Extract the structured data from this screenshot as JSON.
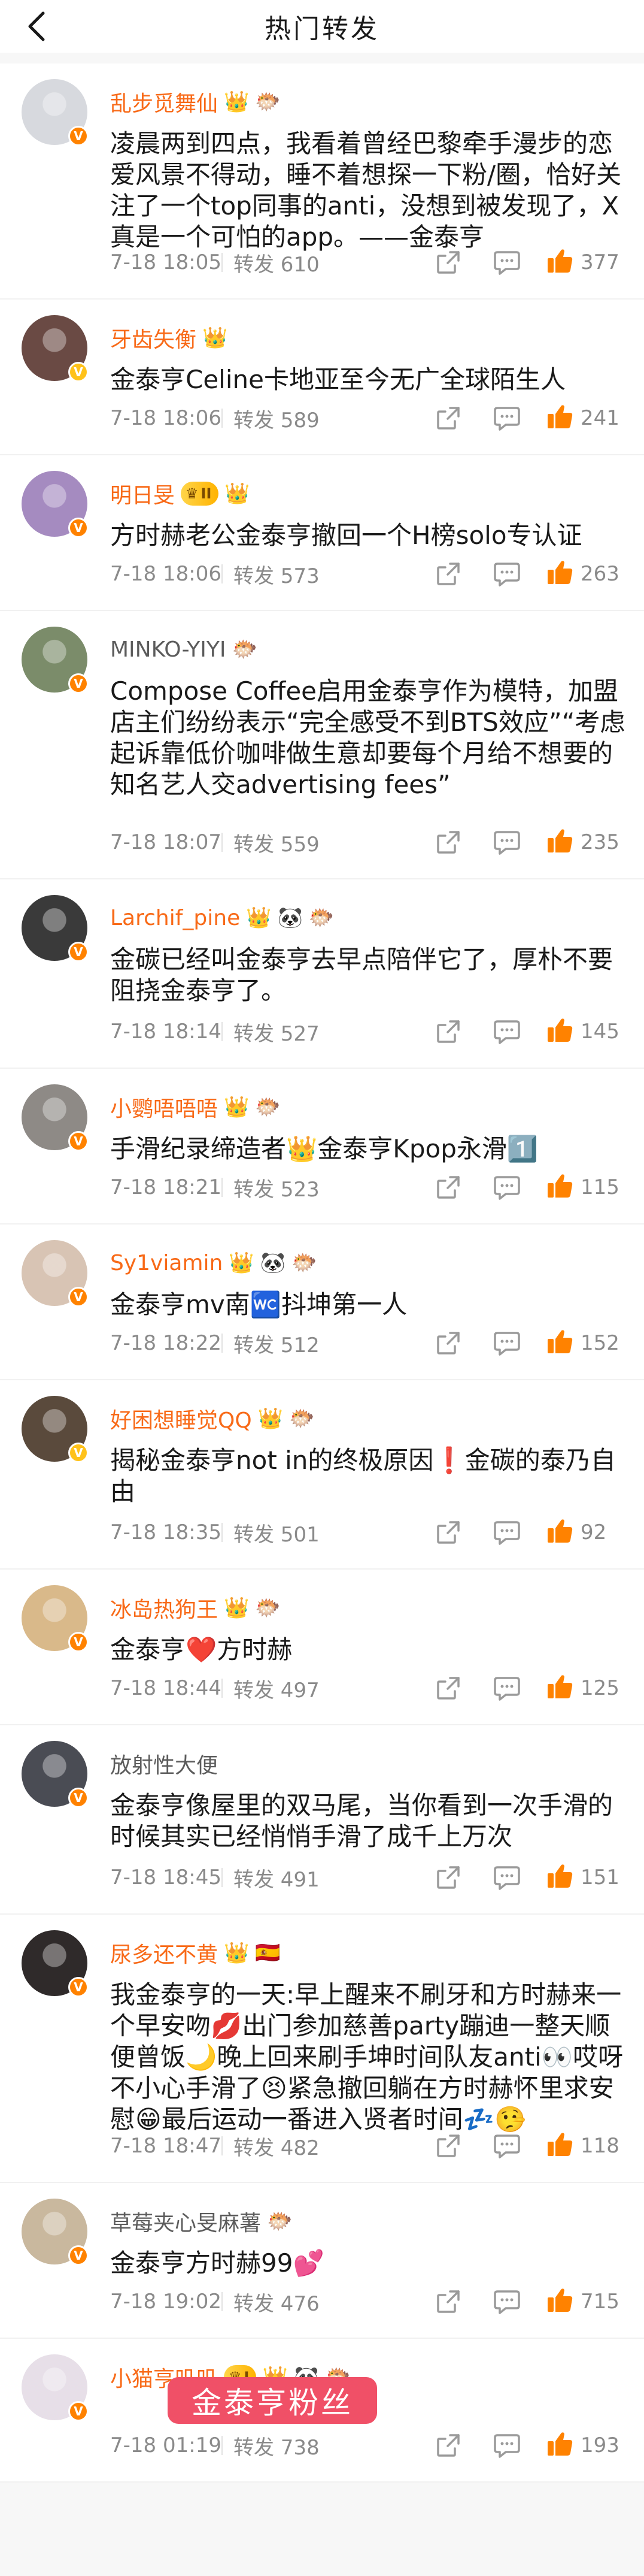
{
  "header": {
    "title": "热门转发"
  },
  "colors": {
    "vip_name": "#f86a18",
    "plain_name": "#5c5c5c",
    "like_icon": "#ff8200",
    "meta_gray": "#8a8a8a",
    "watermark_bg": "#f05067"
  },
  "posts": [
    {
      "username": "乱步觅舞仙",
      "vip": true,
      "badges": [
        "👑",
        "🐡"
      ],
      "avatar_color": "#d7d9de",
      "vbadge": "orange",
      "text": "凌晨两到四点，我看着曾经巴黎牵手漫步的恋爱风景不得动，睡不着想探一下粉/圈，恰好关注了一个top同事的anti，没想到被发现了，X真是一个可怕的app。——金泰亨",
      "lines": 4,
      "time": "7-18 18:05",
      "repost": "转发 610",
      "likes": "377"
    },
    {
      "username": "牙齿失衡",
      "vip": true,
      "badges": [
        "👑"
      ],
      "avatar_color": "#6a4a44",
      "vbadge": "yellow",
      "text": "金泰亨Celine卡地亚至今无广全球陌生人",
      "lines": 1,
      "time": "7-18 18:06",
      "repost": "转发 589",
      "likes": "241"
    },
    {
      "username": "明日旻",
      "vip": true,
      "badges": [
        "👑"
      ],
      "level_badge": "II",
      "avatar_color": "#a58bc0",
      "vbadge": "orange",
      "text": "方时赫老公金泰亨撤回一个H榜solo专认证",
      "lines": 1,
      "time": "7-18 18:06",
      "repost": "转发 573",
      "likes": "263"
    },
    {
      "username": "MINKO-YIYI",
      "vip": false,
      "badges": [
        "🐡"
      ],
      "avatar_color": "#7b8c6a",
      "vbadge": "orange",
      "text": "Compose Coffee启用金泰亨作为模特，加盟店主们纷纷表示“完全感受不到BTS效应”“考虑起诉靠低价咖啡做生意却要每个月给不想要的知名艺人交advertising fees”",
      "lines": 5,
      "time": "7-18 18:07",
      "repost": "转发 559",
      "likes": "235"
    },
    {
      "username": "Larchif_pine",
      "vip": true,
      "badges": [
        "👑",
        "🐼",
        "🐡"
      ],
      "avatar_color": "#3a3a3a",
      "vbadge": "orange",
      "text": "金碳已经叫金泰亨去早点陪伴它了，厚朴不要阻挠金泰亨了。",
      "lines": 2,
      "time": "7-18 18:14",
      "repost": "转发 527",
      "likes": "145"
    },
    {
      "username": "小鹦唔唔唔",
      "vip": true,
      "badges": [
        "👑",
        "🐡"
      ],
      "avatar_color": "#8e8a86",
      "vbadge": "orange",
      "text": "手滑纪录缔造者👑金泰亨Kpop永滑1️⃣",
      "lines": 1,
      "time": "7-18 18:21",
      "repost": "转发 523",
      "likes": "115"
    },
    {
      "username": "Sy1viamin",
      "vip": true,
      "badges": [
        "👑",
        "🐼",
        "🐡"
      ],
      "avatar_color": "#d8c4b4",
      "vbadge": "orange",
      "text": "金泰亨mv南🚾抖坤第一人",
      "lines": 1,
      "time": "7-18 18:22",
      "repost": "转发 512",
      "likes": "152"
    },
    {
      "username": "好困想睡觉QQ",
      "vip": true,
      "badges": [
        "👑",
        "🐡"
      ],
      "avatar_color": "#5a4a3c",
      "vbadge": "yellow",
      "text": "揭秘金泰亨not in的终极原因❗️金碳的泰乃自由",
      "lines": 2,
      "time": "7-18 18:35",
      "repost": "转发 501",
      "likes": "92"
    },
    {
      "username": "冰岛热狗王",
      "vip": true,
      "badges": [
        "👑",
        "🐡"
      ],
      "avatar_color": "#d9b98a",
      "vbadge": "orange",
      "text": "金泰亨❤️方时赫",
      "lines": 1,
      "time": "7-18 18:44",
      "repost": "转发 497",
      "likes": "125"
    },
    {
      "username": "放射性大便",
      "vip": false,
      "badges": [],
      "avatar_color": "#4a4c54",
      "vbadge": "orange",
      "text": "金泰亨像屋里的双马尾，当你看到一次手滑的时候其实已经悄悄手滑了成千上万次",
      "lines": 2,
      "time": "7-18 18:45",
      "repost": "转发 491",
      "likes": "151"
    },
    {
      "username": "尿多还不黄",
      "vip": true,
      "badges": [
        "👑",
        "🇪🇸"
      ],
      "avatar_color": "#2f2a2a",
      "vbadge": "orange",
      "text": "我金泰亨的一天:早上醒来不刷牙和方时赫来一个早安吻💋出门参加慈善party蹦迪一整天顺便曾饭🌙晚上回来刷手坤时间队友anti👀哎呀不小心手滑了😣紧急撤回躺在方时赫怀里求安慰😁最后运动一番进入贤者时间💤🤥",
      "lines": 5,
      "time": "7-18 18:47",
      "repost": "转发 482",
      "likes": "118"
    },
    {
      "username": "草莓夹心旻麻薯",
      "vip": false,
      "badges": [
        "🐡"
      ],
      "avatar_color": "#c9b89e",
      "vbadge": "orange",
      "text": "金泰亨方时赫99💕",
      "lines": 1,
      "time": "7-18 19:02",
      "repost": "转发 476",
      "likes": "715"
    },
    {
      "username": "小猫亨叽叽",
      "vip": true,
      "badges": [
        "👑",
        "🐼",
        "🐡"
      ],
      "level_badge": "I",
      "avatar_color": "#e7dfe8",
      "vbadge": "orange",
      "text": "",
      "lines": 1,
      "time": "7-18 01:19",
      "repost": "转发 738",
      "likes": "193"
    }
  ],
  "watermark": {
    "text": "金泰亨粉丝"
  }
}
